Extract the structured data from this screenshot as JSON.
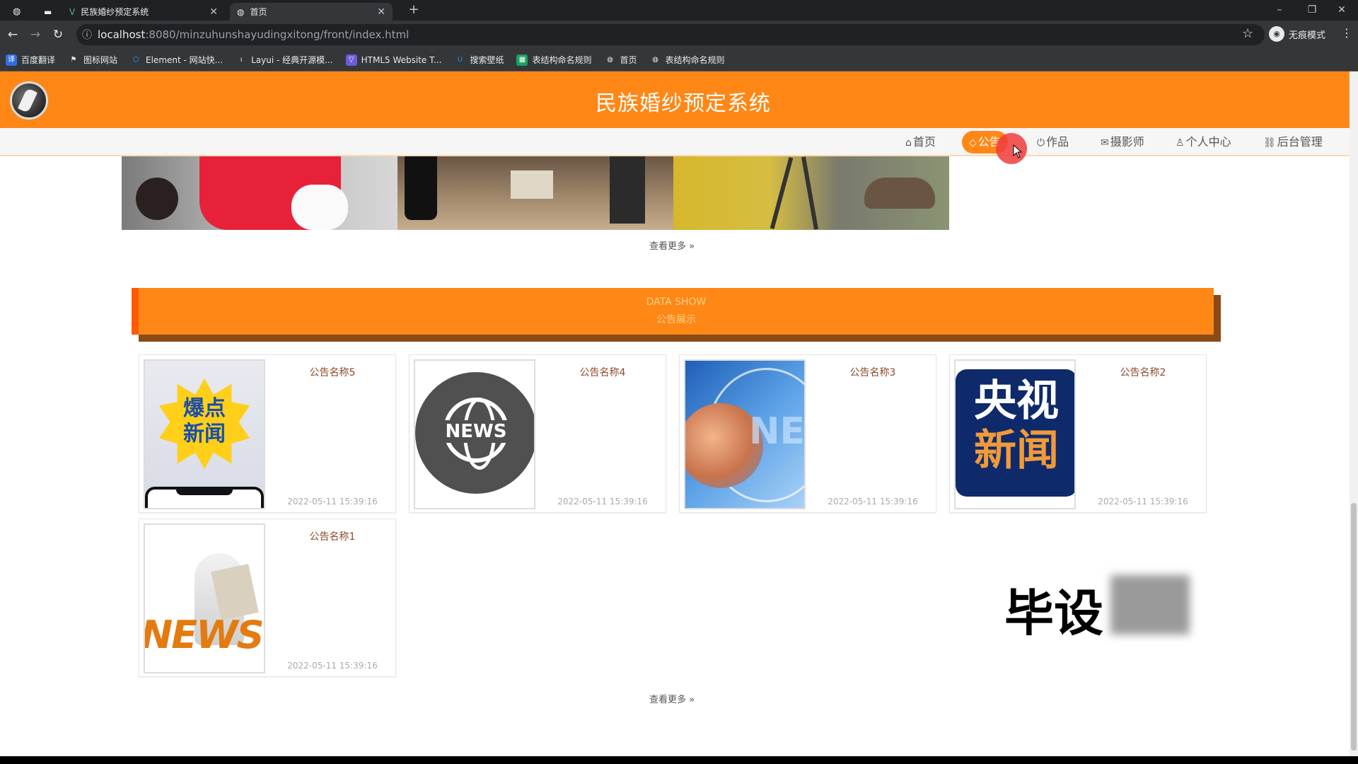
{
  "browser": {
    "tabs": [
      {
        "title": "民族婚纱预定系统",
        "state": "inactive"
      },
      {
        "title": "首页",
        "state": "active"
      }
    ],
    "url_host": "localhost",
    "url_path": ":8080/minzuhunshayudingxitong/front/index.html",
    "incognito_label": "无痕模式",
    "bookmarks": [
      "百度翻译",
      "图标网站",
      "Element - 网站快...",
      "Layui - 经典开源模...",
      "HTML5 Website T...",
      "搜索壁纸",
      "表结构命名规则",
      "首页",
      "表结构命名规则"
    ]
  },
  "site": {
    "title": "民族婚纱预定系统",
    "accent_color": "#ff8716"
  },
  "nav": {
    "items": [
      {
        "label": "首页",
        "icon": "home-icon"
      },
      {
        "label": "公告",
        "icon": "tag-icon",
        "active": true
      },
      {
        "label": "作品",
        "icon": "power-icon"
      },
      {
        "label": "摄影师",
        "icon": "mail-icon"
      },
      {
        "label": "个人中心",
        "icon": "user-icon"
      },
      {
        "label": "后台管理",
        "icon": "link-icon"
      }
    ]
  },
  "works": {
    "more_label": "查看更多"
  },
  "notice_section": {
    "title_en": "DATA SHOW",
    "title_cn": "公告展示",
    "more_label": "查看更多",
    "cards": [
      {
        "name": "公告名称5",
        "date": "2022-05-11 15:39:16"
      },
      {
        "name": "公告名称4",
        "date": "2022-05-11 15:39:16"
      },
      {
        "name": "公告名称3",
        "date": "2022-05-11 15:39:16"
      },
      {
        "name": "公告名称2",
        "date": "2022-05-11 15:39:16"
      },
      {
        "name": "公告名称1",
        "date": "2022-05-11 15:39:16"
      }
    ],
    "thumb_texts": {
      "card5": "爆点\n新闻",
      "card4": "NEWS",
      "card3": "NEW",
      "card2_line1": "央视",
      "card2_line2": "新闻",
      "card1": "NEWS"
    }
  },
  "watermark": "毕设"
}
